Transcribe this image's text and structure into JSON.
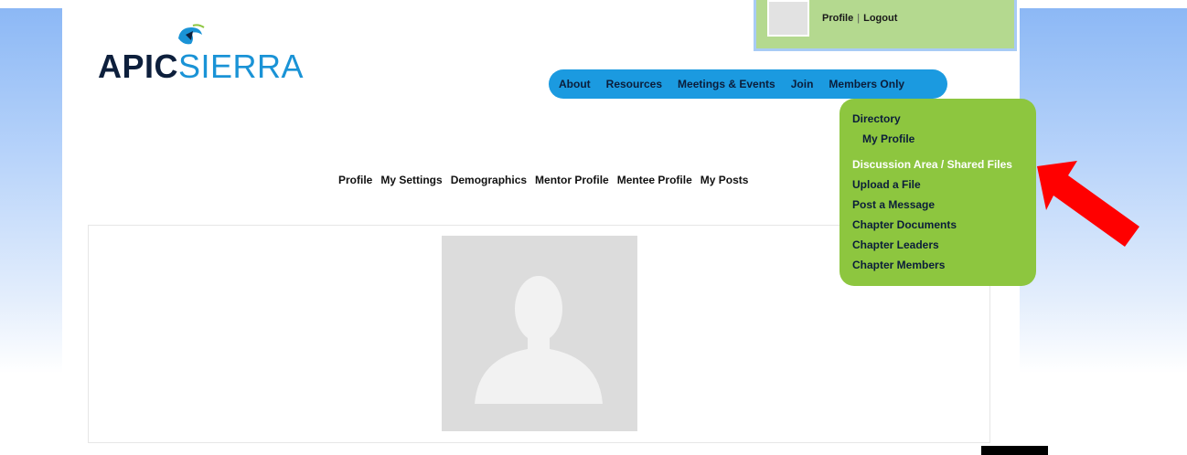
{
  "logo": {
    "part1": "APIC",
    "part2": "SIERRA"
  },
  "user_box": {
    "profile_link": "Profile",
    "logout_link": "Logout"
  },
  "main_nav": [
    "About",
    "Resources",
    "Meetings & Events",
    "Join",
    "Members Only"
  ],
  "dropdown": {
    "items": [
      {
        "label": "Directory"
      },
      {
        "label": "My Profile",
        "sub": true
      },
      {
        "label": "Discussion Area / Shared Files",
        "active": true
      },
      {
        "label": "Upload a File"
      },
      {
        "label": "Post a Message"
      },
      {
        "label": "Chapter Documents"
      },
      {
        "label": "Chapter Leaders"
      },
      {
        "label": "Chapter Members"
      }
    ]
  },
  "sub_nav": [
    "Profile",
    "My Settings",
    "Demographics",
    "Mentor Profile",
    "Mentee Profile",
    "My Posts"
  ],
  "colors": {
    "nav_blue": "#1b9ae0",
    "dropdown_green": "#8dc63f",
    "user_box_green": "#b4d98f",
    "arrow_red": "#ff0000"
  }
}
